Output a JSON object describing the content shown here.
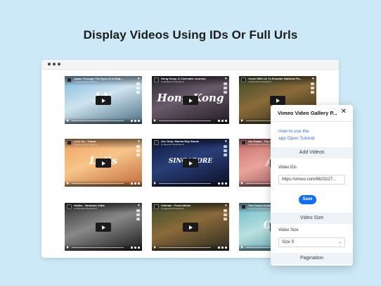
{
  "headline": "Display Videos Using IDs Or Full Urls",
  "tiles": [
    {
      "title": "Japan Through The Eyes Of A Skat...",
      "byline": "by Beautiful Destinations",
      "word": "J  N",
      "colors": [
        "#7fb8e0",
        "#cfe3ef",
        "#4b6f86"
      ]
    },
    {
      "title": "Hong Kong: A Cinematic Journey",
      "byline": "by Beautiful Destinations",
      "word": "Hong Kong",
      "colors": [
        "#2a2a35",
        "#6a5a6a",
        "#201a22"
      ]
    },
    {
      "title": "Come With Us To Ecuador National Pa...",
      "byline": "by Beautiful Destinations",
      "word": "",
      "colors": [
        "#3d4a2a",
        "#8a6a3a",
        "#2a2a1a"
      ]
    },
    {
      "title": "Let's Go - Tulum",
      "byline": "by Beautiful Destinations",
      "word": "Let's",
      "colors": [
        "#f0a060",
        "#f7c58a",
        "#c06a38"
      ]
    },
    {
      "title": "Our Duty: Marina Bay Sands",
      "byline": "by Beautiful Destinations",
      "word": "SINGAPORE",
      "colors": [
        "#0e1a3a",
        "#2a3e7a",
        "#0a0f22"
      ]
    },
    {
      "title": "Ain Dubai - The Worlds Sig...",
      "byline": "by Beautiful Destinations",
      "word": "Ain",
      "colors": [
        "#c56a6a",
        "#e9a59a",
        "#7a3a4a"
      ]
    },
    {
      "title": "Holika - Varanasi, India",
      "byline": "by Beautiful Destinations",
      "word": "",
      "colors": [
        "#333333",
        "#888888",
        "#1a1a1a"
      ]
    },
    {
      "title": "Vietnam - From Above",
      "byline": "by Beautiful Destinations",
      "word": "",
      "colors": [
        "#3a4a2a",
        "#8a6a3a",
        "#2a2a20"
      ]
    },
    {
      "title": "The Cocos Keeling Islands",
      "byline": "by Beautiful Destinations",
      "word": "Coco",
      "colors": [
        "#6ab8c8",
        "#b8e0e0",
        "#3a8a98"
      ]
    }
  ],
  "panel": {
    "title": "Vimeo Video Gallery P...",
    "close": "✕",
    "help_line1": "How to use the",
    "help_prefix": "app",
    "help_link": "Open Tutorial",
    "section_add": "Add Videos",
    "video_ids_label": "Video IDs",
    "video_ids_value": "https://vimeo.com/5620227...",
    "save_label": "Save",
    "section_size": "Video Size",
    "size_label": "Video Size",
    "size_value": "Size S",
    "section_pagination": "Pagination"
  }
}
